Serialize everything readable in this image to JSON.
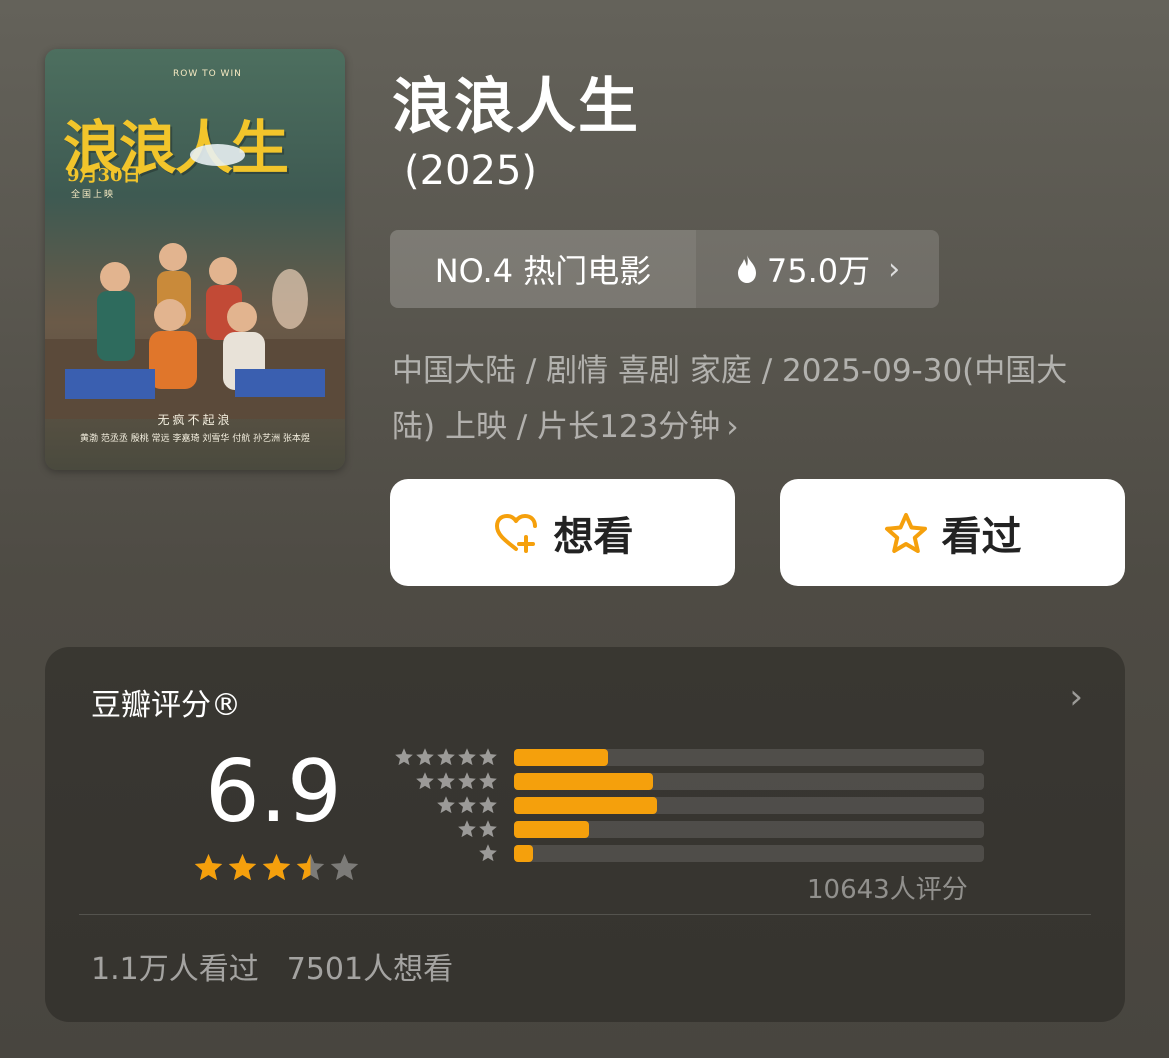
{
  "movie": {
    "title": "浪浪人生",
    "year": "(2025)",
    "poster": {
      "title": "浪浪人生",
      "english_title": "ROW TO WIN",
      "release_date": "9月30日",
      "release_sub": "全国上映",
      "tagline": "无疯不起浪",
      "credits": "黄渤  范丞丞  殷桃  常远  李嘉琦  刘雪华  付航  孙艺洲  张本煜"
    },
    "rank": {
      "label": "NO.4 热门电影",
      "heat": "75.0万",
      "heat_icon": "flame-icon"
    },
    "meta_line1": "中国大陆 / 剧情 喜剧 家庭 / 2025-09-30(中国大",
    "meta_line2": "陆) 上映 / 片长123分钟"
  },
  "actions": {
    "want_label": "想看",
    "want_icon": "heart-plus-icon",
    "seen_label": "看过",
    "seen_icon": "star-outline-icon",
    "accent": "#f5a00c"
  },
  "rating": {
    "section_title": "豆瓣评分®",
    "score": "6.9",
    "stars_value": 3.5,
    "stars_max": 5,
    "distribution": [
      {
        "stars": 5,
        "fraction": 0.2
      },
      {
        "stars": 4,
        "fraction": 0.295
      },
      {
        "stars": 3,
        "fraction": 0.305
      },
      {
        "stars": 2,
        "fraction": 0.16
      },
      {
        "stars": 1,
        "fraction": 0.04
      }
    ],
    "count_text": "10643人评分",
    "seen_count": "1.1万人看过",
    "want_count": "7501人想看",
    "bar_color": "#f5a00c"
  }
}
